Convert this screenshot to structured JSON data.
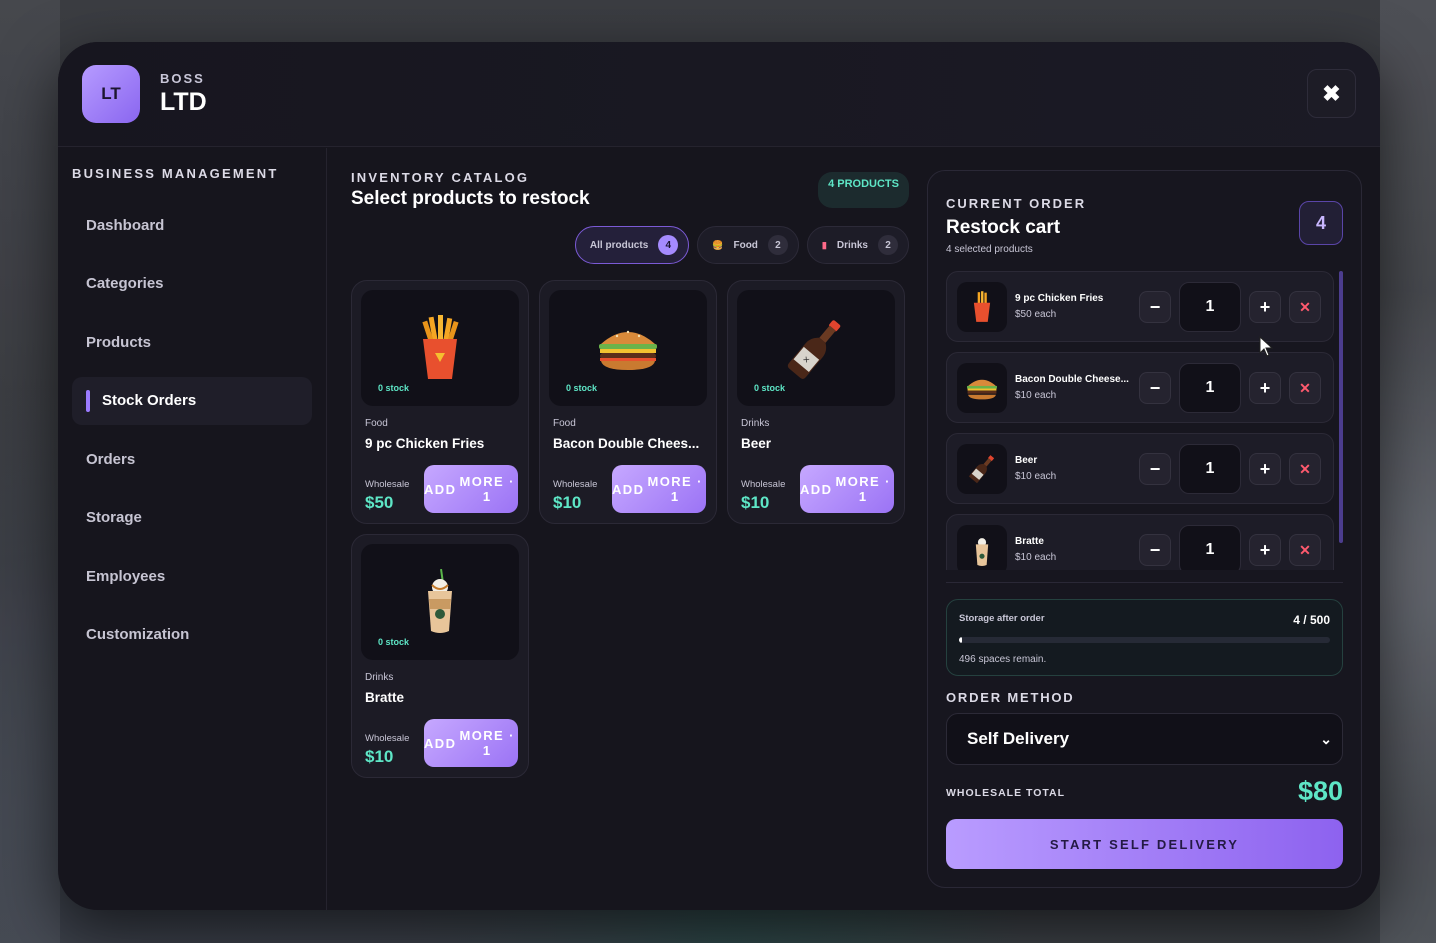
{
  "header": {
    "logo": "LT",
    "brand_small": "BOSS",
    "brand_big": "LTD",
    "close_icon": "close-icon"
  },
  "sidebar": {
    "title": "BUSINESS MANAGEMENT",
    "items": [
      {
        "label": "Dashboard",
        "active": false
      },
      {
        "label": "Categories",
        "active": false
      },
      {
        "label": "Products",
        "active": false
      },
      {
        "label": "Stock Orders",
        "active": true
      },
      {
        "label": "Orders",
        "active": false
      },
      {
        "label": "Storage",
        "active": false
      },
      {
        "label": "Employees",
        "active": false
      },
      {
        "label": "Customization",
        "active": false
      }
    ]
  },
  "catalog": {
    "label": "INVENTORY CATALOG",
    "title": "Select products to restock",
    "count_badge": "4 PRODUCTS",
    "filters": [
      {
        "label": "All products",
        "count": "4",
        "active": true,
        "icon": ""
      },
      {
        "label": "Food",
        "count": "2",
        "active": false,
        "icon": "burger-icon"
      },
      {
        "label": "Drinks",
        "count": "2",
        "active": false,
        "icon": "cup-icon"
      }
    ],
    "products": [
      {
        "category": "Food",
        "name": "9 pc Chicken Fries",
        "stock": "0 stock",
        "wholesale_label": "Wholesale",
        "price": "$50",
        "button": "ADD MORE · 1",
        "image": "fries"
      },
      {
        "category": "Food",
        "name": "Bacon Double Chees...",
        "stock": "0 stock",
        "wholesale_label": "Wholesale",
        "price": "$10",
        "button": "ADD MORE · 1",
        "image": "burger"
      },
      {
        "category": "Drinks",
        "name": "Beer",
        "stock": "0 stock",
        "wholesale_label": "Wholesale",
        "price": "$10",
        "button": "ADD MORE · 1",
        "image": "beer"
      },
      {
        "category": "Drinks",
        "name": "Bratte",
        "stock": "0 stock",
        "wholesale_label": "Wholesale",
        "price": "$10",
        "button": "ADD MORE · 1",
        "image": "bratte"
      }
    ]
  },
  "order": {
    "label": "CURRENT ORDER",
    "title": "Restock cart",
    "subtitle": "4 selected products",
    "count": "4",
    "items": [
      {
        "name": "9 pc Chicken Fries",
        "price": "$50 each",
        "qty": "1",
        "image": "fries"
      },
      {
        "name": "Bacon Double Cheese...",
        "price": "$10 each",
        "qty": "1",
        "image": "burger"
      },
      {
        "name": "Beer",
        "price": "$10 each",
        "qty": "1",
        "image": "beer"
      },
      {
        "name": "Bratte",
        "price": "$10 each",
        "qty": "1",
        "image": "bratte"
      }
    ],
    "storage": {
      "label": "Storage after order",
      "value": "4 / 500",
      "fill_fraction": 0.008,
      "note": "496 spaces remain."
    },
    "method_label": "ORDER METHOD",
    "method_value": "Self Delivery",
    "total_label": "WHOLESALE TOTAL",
    "total_value": "$80",
    "start_button": "START SELF DELIVERY"
  },
  "colors": {
    "accent": "#9b7bff",
    "money": "#5ee6c6",
    "danger": "#ff5a6e"
  }
}
